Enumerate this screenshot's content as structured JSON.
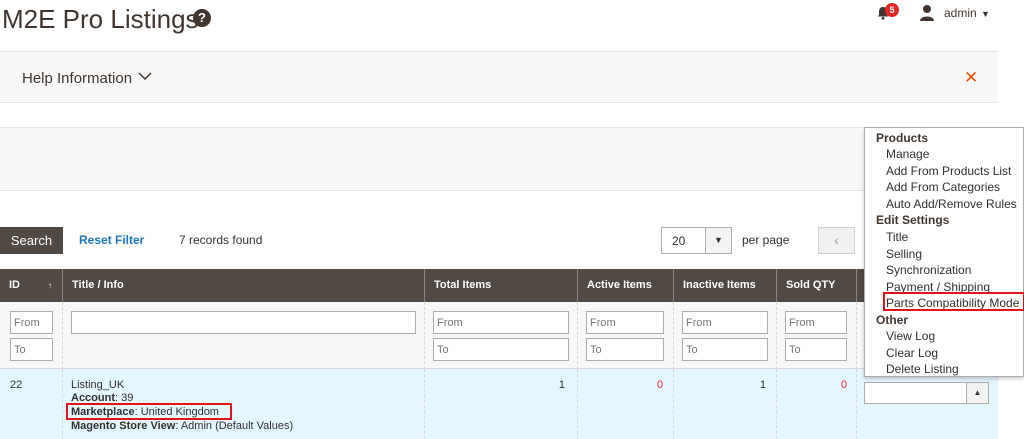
{
  "header": {
    "title": "M2E Pro Listings",
    "help_icon": "?",
    "notifications_count": "5",
    "user_name": "admin"
  },
  "help_box": {
    "label": "Help Information",
    "close_glyph": "✕"
  },
  "toolbar": {
    "search_label": "Search",
    "reset_label": "Reset Filter",
    "records_text": "7 records found",
    "per_page_value": "20",
    "per_page_label": "per page",
    "prev_glyph": "‹"
  },
  "table": {
    "columns": [
      "ID",
      "Title / Info",
      "Total Items",
      "Active Items",
      "Inactive Items",
      "Sold QTY"
    ],
    "filter_placeholders": {
      "from": "From",
      "to": "To"
    },
    "row": {
      "id": "22",
      "title": "Listing_UK",
      "account_label": "Account",
      "account_value": ": 39",
      "marketplace_label": "Marketplace",
      "marketplace_value": ": United Kingdom",
      "store_label": "Magento Store View",
      "store_value": ": Admin (Default Values)",
      "total_items": "1",
      "active_items": "0",
      "inactive_items": "1",
      "sold_qty": "0"
    }
  },
  "actions_menu": {
    "groups": [
      {
        "title": "Products",
        "items": [
          "Manage",
          "Add From Products List",
          "Add From Categories",
          "Auto Add/Remove Rules"
        ]
      },
      {
        "title": "Edit Settings",
        "items": [
          "Title",
          "Selling",
          "Synchronization",
          "Payment / Shipping",
          "Parts Compatibility Mode"
        ]
      },
      {
        "title": "Other",
        "items": [
          "View Log",
          "Clear Log",
          "Delete Listing"
        ]
      }
    ]
  },
  "colors": {
    "header_bg": "#514943",
    "link": "#1979c3",
    "accent": "#eb5202",
    "highlight_border": "#e0151b",
    "row_bg": "#e5f7fe"
  }
}
